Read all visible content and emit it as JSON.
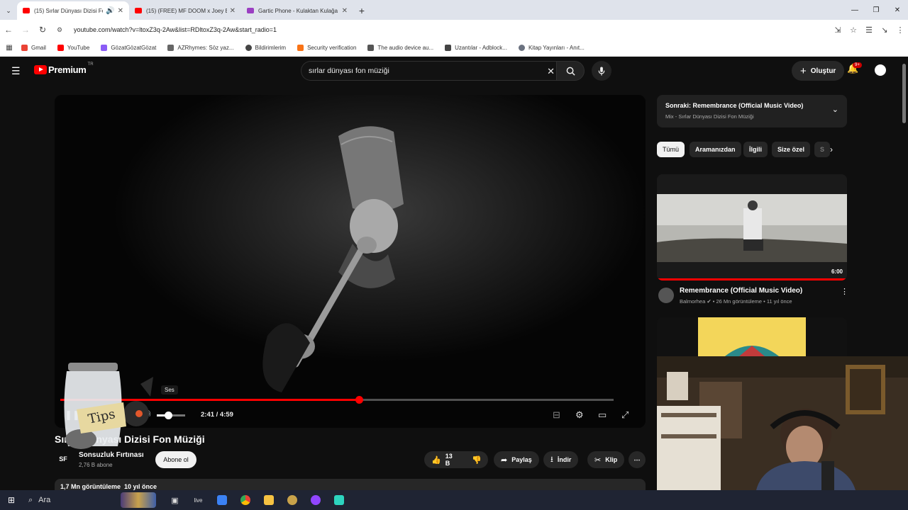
{
  "browser": {
    "tabs": [
      {
        "title": "(15) Sırlar Dünyası Dizisi Fo",
        "active": true,
        "favicon_color": "#ff0000",
        "audio": true
      },
      {
        "title": "(15) (FREE) MF DOOM x Joey B",
        "active": false,
        "favicon_color": "#ff0000"
      },
      {
        "title": "Gartic Phone - Kulaktan Kulağa",
        "active": false,
        "favicon_color": "#9b3fc2"
      }
    ],
    "new_tab": "+",
    "url": "youtube.com/watch?v=ltoxZ3q-2Aw&list=RDltoxZ3q-2Aw&start_radio=1",
    "bookmarks": [
      {
        "label": "Gmail",
        "color": "#ea4335"
      },
      {
        "label": "YouTube",
        "color": "#ff0000"
      },
      {
        "label": "GözatGözatGözat",
        "color": "#8b5cf6"
      },
      {
        "label": "AZRhymes: Söz yaz...",
        "color": "#666666"
      },
      {
        "label": "Bildirimlerim",
        "color": "#444444"
      },
      {
        "label": "Security verification",
        "color": "#f97316"
      },
      {
        "label": "The audio device au...",
        "color": "#555555"
      },
      {
        "label": "Uzantılar - Adblock...",
        "color": "#444444"
      },
      {
        "label": "Kitap Yayınları - Anıt...",
        "color": "#6b7280"
      }
    ]
  },
  "youtube": {
    "logo_text": "Premium",
    "logo_country": "TR",
    "search_value": "sırlar dünyası fon müziği",
    "create_label": "Oluştur",
    "notif_count": "9+",
    "player": {
      "time": "2:41 / 4:59",
      "progress": 0.54,
      "volume": 0.4,
      "tooltip": "Ses"
    },
    "video_title": "Sırlar Dünyası Dizisi Fon Müziği",
    "channel": {
      "logo": "SF",
      "name": "Sonsuzluk Fırtınası",
      "subs": "2,76 B abone"
    },
    "subscribe_label": "Abone ol",
    "actions": {
      "likes": "13 B",
      "share": "Paylaş",
      "download": "İndir",
      "clip": "Klip"
    },
    "stats": {
      "views": "1,7 Mn görüntüleme",
      "age": "10 yıl önce"
    },
    "up_next": {
      "title": "Sonraki: Remembrance (Official Music Video)",
      "subtitle": "Mix - Sırlar Dünyası Dizisi Fon Müziği"
    },
    "chips": [
      "Tümü",
      "Aramanızdan",
      "İlgili",
      "Size özel",
      "S"
    ],
    "recommended": [
      {
        "title": "Remembrance (Official Music Video)",
        "channel": "Balmorhea",
        "meta": "26 Mn görüntüleme • 11 yıl önce",
        "duration": "6:00"
      }
    ]
  },
  "overlay": {
    "jar_label": "Tips"
  },
  "taskbar": {
    "search_label": "Ara",
    "icons": [
      {
        "name": "taskview-icon",
        "color": "#dddddd"
      },
      {
        "name": "live-icon",
        "color": "#dddddd"
      },
      {
        "name": "store-icon",
        "color": "#3b82f6"
      },
      {
        "name": "chrome-icon",
        "color": "#34a853"
      },
      {
        "name": "explorer-icon",
        "color": "#f5c242"
      },
      {
        "name": "league-icon",
        "color": "#c8a24a"
      },
      {
        "name": "twitch-icon",
        "color": "#9146ff"
      },
      {
        "name": "app-icon",
        "color": "#2dd4bf"
      }
    ]
  }
}
